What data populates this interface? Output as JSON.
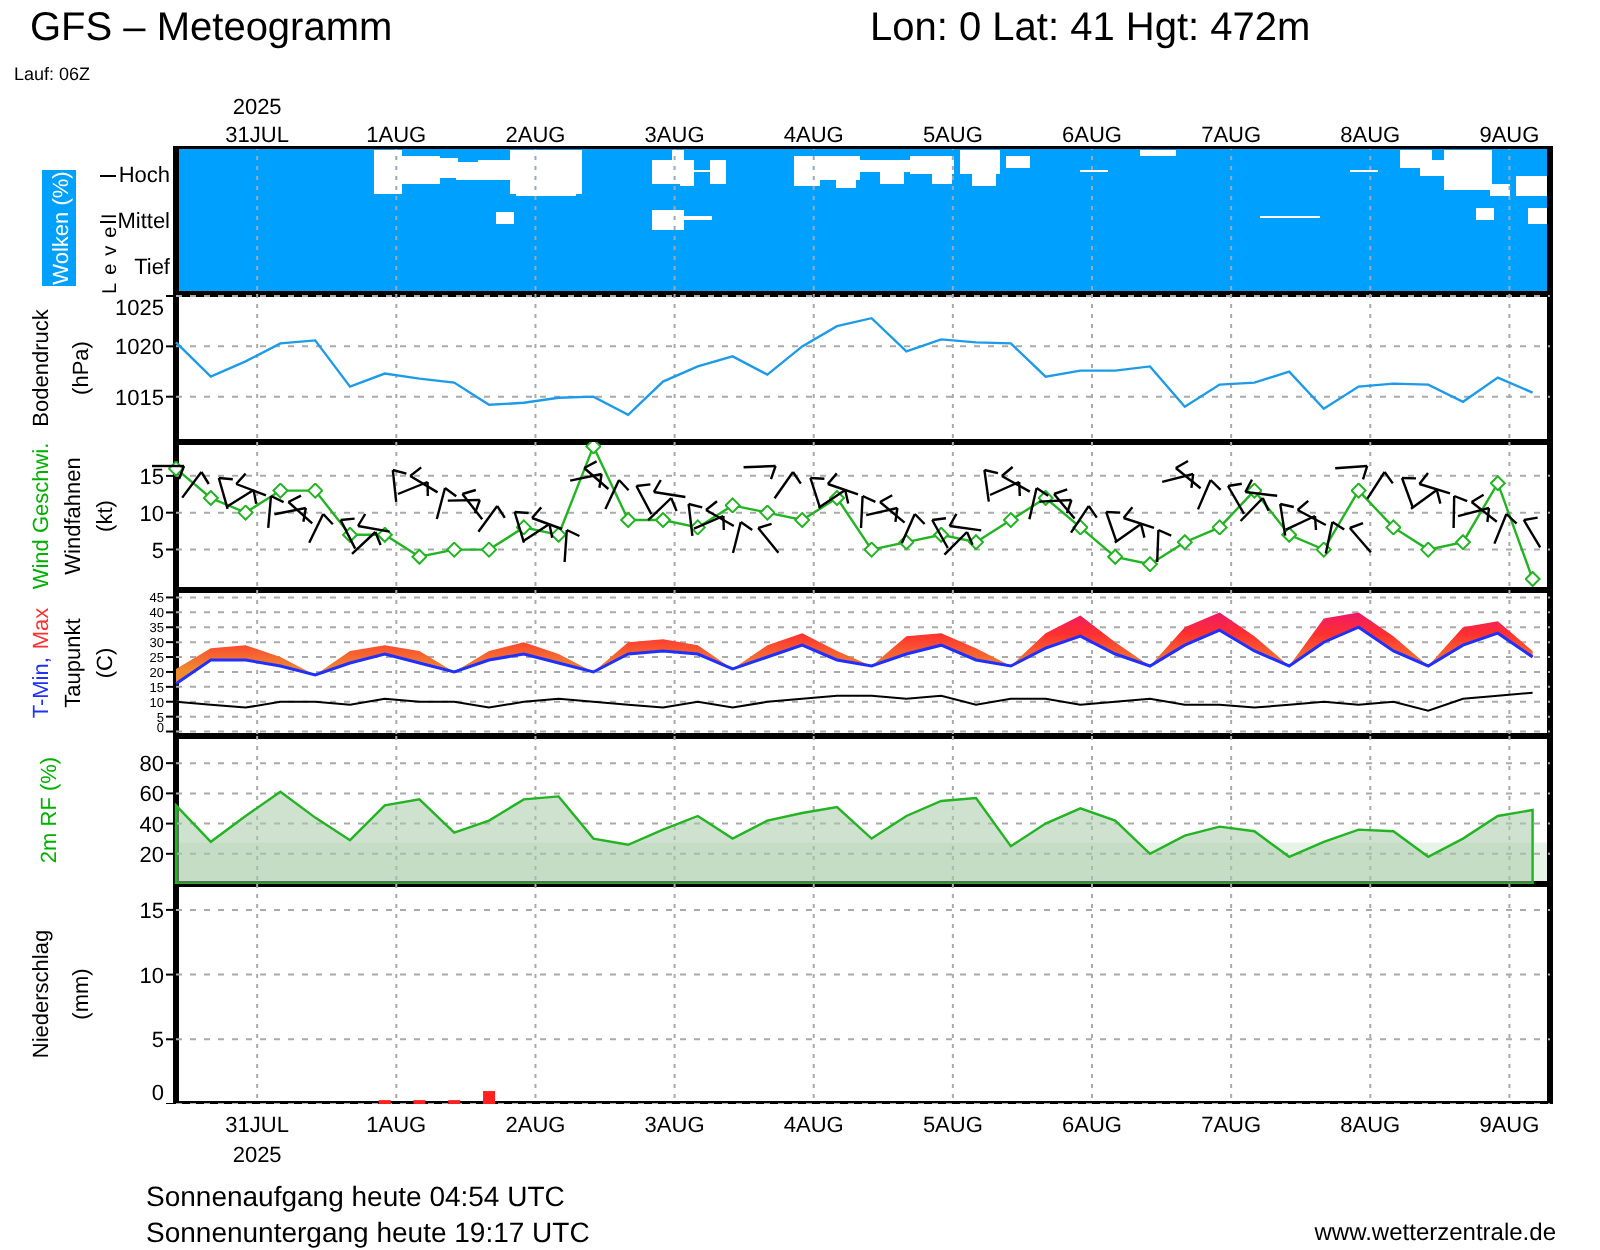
{
  "header": {
    "title": "GFS – Meteogramm",
    "location": "Lon: 0 Lat: 41 Hgt: 472m",
    "run": "Lauf: 06Z"
  },
  "top_axis": {
    "year": "2025",
    "days": [
      "31JUL",
      "1AUG",
      "2AUG",
      "3AUG",
      "4AUG",
      "5AUG",
      "6AUG",
      "7AUG",
      "8AUG",
      "9AUG"
    ]
  },
  "panels": [
    {
      "kind": "clouds",
      "title": "Wolken (%)",
      "axis_title": "Level",
      "levels": [
        "Hoch",
        "Mittel",
        "Tief"
      ]
    },
    {
      "kind": "pressure",
      "label_lines": [
        [
          {
            "text": "Bodendruck",
            "color": "#000000"
          }
        ],
        [
          {
            "text": "(hPa)",
            "color": "#000000"
          }
        ]
      ],
      "chart_data": {
        "type": "line",
        "grid": true,
        "ylim": [
          1010.5,
          1025.2
        ],
        "yticks": [
          1015,
          1020,
          1025
        ],
        "categories": [
          null,
          null,
          null,
          null,
          null,
          null,
          null,
          null,
          null,
          null,
          null,
          null,
          null,
          null,
          null,
          null,
          null,
          null,
          null,
          null,
          null,
          null,
          null,
          null,
          null,
          null,
          null,
          null,
          null,
          null,
          null,
          null,
          null,
          null,
          null,
          null,
          null,
          null,
          null,
          null
        ],
        "series": [
          {
            "color": "#1e9be8",
            "values": [
              1020.4,
              1017,
              1018.5,
              1020.3,
              1020.6,
              1016,
              1017.3,
              1016.8,
              1016.4,
              1014.2,
              1014.4,
              1014.9,
              1015,
              1013.2,
              1016.5,
              1018,
              1019,
              1017.2,
              1020,
              1022,
              1022.8,
              1019.5,
              1020.7,
              1020.4,
              1020.3,
              1017,
              1017.6,
              1017.6,
              1018,
              1014,
              1016.2,
              1016.4,
              1017.5,
              1013.8,
              1016,
              1016.3,
              1016.2,
              1014.5,
              1016.9,
              1015.4
            ]
          }
        ]
      }
    },
    {
      "kind": "wind",
      "label_lines": [
        [
          {
            "text": "Wind Geschwi.",
            "color": "#00b000"
          }
        ],
        [
          {
            "text": "Windfahnen",
            "color": "#000000"
          }
        ],
        [
          {
            "text": "(kt)",
            "color": "#000000"
          }
        ]
      ],
      "chart_data": {
        "type": "line",
        "grid": true,
        "ylim": [
          -0.5,
          19.6
        ],
        "yticks": [
          5,
          10,
          15
        ],
        "categories": [
          null,
          null,
          null,
          null,
          null,
          null,
          null,
          null,
          null,
          null,
          null,
          null,
          null,
          null,
          null,
          null,
          null,
          null,
          null,
          null,
          null,
          null,
          null,
          null,
          null,
          null,
          null,
          null,
          null,
          null,
          null,
          null,
          null,
          null,
          null,
          null,
          null,
          null,
          null,
          null
        ],
        "series": [
          {
            "color": "#22b422",
            "values": [
              16,
              12,
              10,
              13,
              13,
              7,
              7,
              4,
              5,
              5,
              8,
              7,
              19,
              9,
              9,
              8,
              11,
              10,
              9,
              12,
              5,
              6,
              7,
              6,
              9,
              12,
              8,
              4,
              3,
              6,
              8,
              13,
              7,
              5,
              13,
              8,
              5,
              6,
              14,
              1
            ]
          }
        ]
      }
    },
    {
      "kind": "temperature",
      "label_lines": [
        [
          {
            "text": "T-Min,",
            "color": "#2030ff"
          },
          {
            "text": "Max",
            "color": "#ff3030"
          }
        ],
        [
          {
            "text": "Taupunkt",
            "color": "#000000"
          }
        ],
        [
          {
            "text": "(C)",
            "color": "#000000"
          }
        ]
      ],
      "chart_data": {
        "type": "line",
        "grid": true,
        "ylim": [
          -1.5,
          47.5
        ],
        "yticks": [
          0,
          5,
          10,
          15,
          20,
          25,
          30,
          35,
          40,
          45
        ],
        "categories": [
          null,
          null,
          null,
          null,
          null,
          null,
          null,
          null,
          null,
          null,
          null,
          null,
          null,
          null,
          null,
          null,
          null,
          null,
          null,
          null,
          null,
          null,
          null,
          null,
          null,
          null,
          null,
          null,
          null,
          null,
          null,
          null,
          null,
          null,
          null,
          null,
          null,
          null,
          null,
          null
        ],
        "series": [
          {
            "color": "#2030ff",
            "values": [
              16,
              24,
              24,
              22,
              19,
              23,
              26,
              23,
              20,
              24,
              26,
              23,
              20,
              26,
              27,
              26,
              21,
              25,
              29,
              24,
              22,
              26,
              29,
              24,
              22,
              28,
              32,
              26,
              22,
              29,
              34,
              27,
              22,
              30,
              35,
              27,
              22,
              29,
              33,
              25
            ]
          },
          {
            "color": "#ff3030",
            "type": "area",
            "values": [
              21,
              28,
              29,
              25,
              19,
              27,
              29,
              27,
              20,
              27,
              30,
              26,
              20,
              30,
              31,
              29,
              21,
              29,
              33,
              27,
              22,
              32,
              33,
              28,
              22,
              33,
              39,
              30,
              22,
              35,
              40,
              32,
              22,
              38,
              40,
              32,
              22,
              35,
              37,
              27
            ]
          },
          {
            "color": "#000000",
            "values": [
              10,
              9,
              8,
              10,
              10,
              9,
              11,
              10,
              10,
              8,
              10,
              11,
              10,
              9,
              8,
              10,
              8,
              10,
              11,
              12,
              12,
              11,
              12,
              9,
              11,
              11,
              9,
              10,
              11,
              9,
              9,
              8,
              9,
              10,
              9,
              10,
              7,
              11,
              12,
              13
            ]
          }
        ]
      }
    },
    {
      "kind": "humidity",
      "label_lines": [
        [
          {
            "text": "2m RF (%)",
            "color": "#00b000"
          }
        ]
      ],
      "chart_data": {
        "type": "area",
        "grid": true,
        "ylim": [
          0,
          98
        ],
        "yticks": [
          20,
          40,
          60,
          80
        ],
        "categories": [
          null,
          null,
          null,
          null,
          null,
          null,
          null,
          null,
          null,
          null,
          null,
          null,
          null,
          null,
          null,
          null,
          null,
          null,
          null,
          null,
          null,
          null,
          null,
          null,
          null,
          null,
          null,
          null,
          null,
          null,
          null,
          null,
          null,
          null,
          null,
          null,
          null,
          null,
          null,
          null
        ],
        "series": [
          {
            "color": "#22b422",
            "values": [
              52,
              28,
              45,
              61,
              44,
              29,
              52,
              56,
              34,
              42,
              56,
              58,
              30,
              26,
              36,
              45,
              30,
              42,
              47,
              51,
              30,
              45,
              55,
              57,
              25,
              40,
              50,
              42,
              20,
              32,
              38,
              35,
              18,
              28,
              36,
              35,
              18,
              30,
              45,
              49
            ]
          }
        ]
      }
    },
    {
      "kind": "precipitation",
      "label_lines": [
        [
          {
            "text": "Niederschlag",
            "color": "#000000"
          }
        ],
        [
          {
            "text": "(mm)",
            "color": "#000000"
          }
        ]
      ],
      "chart_data": {
        "type": "bar",
        "grid": true,
        "ylim": [
          0,
          17
        ],
        "yticks": [
          0,
          5,
          10,
          15
        ],
        "categories": [
          null,
          null,
          null,
          null,
          null,
          null,
          null,
          null,
          null,
          null,
          null,
          null,
          null,
          null,
          null,
          null,
          null,
          null,
          null,
          null,
          null,
          null,
          null,
          null,
          null,
          null,
          null,
          null,
          null,
          null,
          null,
          null,
          null,
          null,
          null,
          null,
          null,
          null,
          null,
          null
        ],
        "series": [
          {
            "color": "#ff2020",
            "values": [
              null,
              null,
              null,
              null,
              null,
              null,
              0.3,
              0.3,
              0.3,
              1.0,
              null,
              null,
              null,
              null,
              null,
              null,
              null,
              null,
              null,
              null,
              null,
              null,
              null,
              null,
              null,
              null,
              null,
              null,
              null,
              null,
              null,
              null,
              null,
              null,
              null,
              null,
              null,
              null,
              null,
              null
            ]
          }
        ]
      }
    }
  ],
  "bottom_axis": {
    "days": [
      "31JUL",
      "1AUG",
      "2AUG",
      "3AUG",
      "4AUG",
      "5AUG",
      "6AUG",
      "7AUG",
      "8AUG",
      "9AUG"
    ],
    "year": "2025"
  },
  "footer": {
    "sunrise": "Sonnenaufgang heute 04:54 UTC",
    "sunset": "Sonnenuntergang heute 19:17 UTC",
    "site": "www.wetterzentrale.de"
  }
}
